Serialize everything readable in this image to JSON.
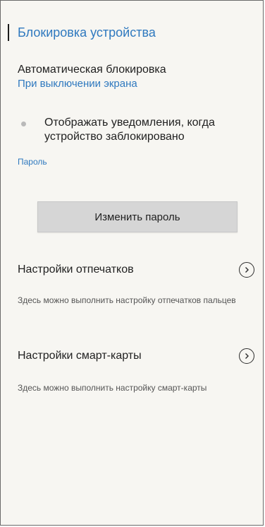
{
  "section": {
    "title": "Блокировка устройства"
  },
  "auto_lock": {
    "title": "Автоматическая блокировка",
    "value": "При выключении экрана"
  },
  "notifications_option": {
    "label": "Отображать уведомления, когда устройство заблокировано"
  },
  "password": {
    "label": "Пароль",
    "change_button": "Изменить пароль"
  },
  "fingerprint": {
    "title": "Настройки отпечатков",
    "description": "Здесь можно выполнить настройку отпечатков пальцев",
    "icon": "chevron-right-circle-icon"
  },
  "smart_card": {
    "title": "Настройки смарт-карты",
    "description": "Здесь можно выполнить настройку смарт-карты",
    "icon": "chevron-right-circle-icon"
  },
  "colors": {
    "accent": "#2f79bf",
    "background": "#f7f6f2",
    "button": "#d6d6d6"
  }
}
